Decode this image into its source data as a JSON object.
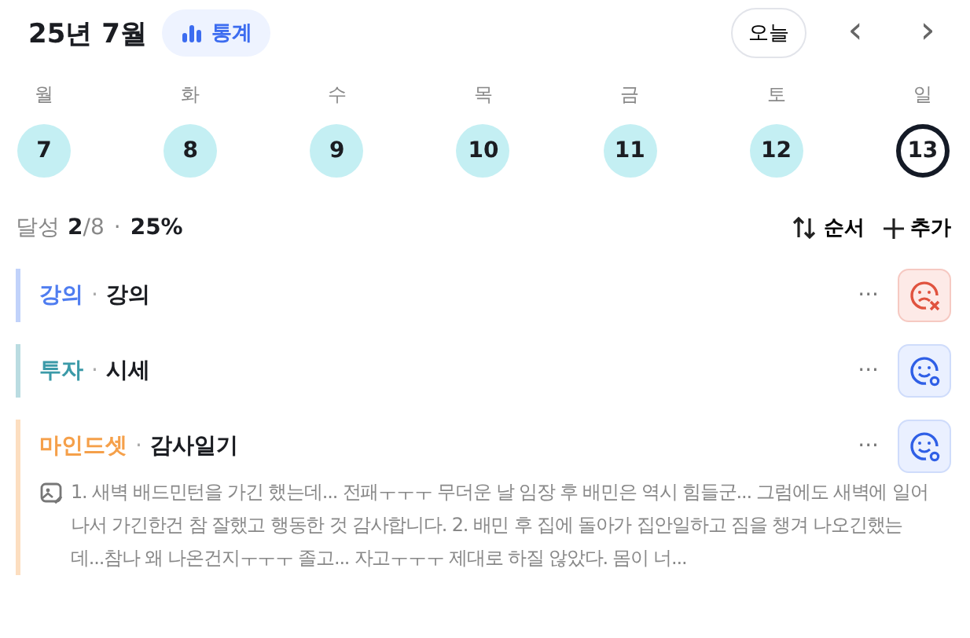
{
  "header": {
    "title": "25년 7월",
    "stats_button": "통계",
    "today_button": "오늘",
    "prev": "‹",
    "next": "›"
  },
  "days": [
    {
      "weekday": "월",
      "date": "7",
      "selected": false
    },
    {
      "weekday": "화",
      "date": "8",
      "selected": false
    },
    {
      "weekday": "수",
      "date": "9",
      "selected": false
    },
    {
      "weekday": "목",
      "date": "10",
      "selected": false
    },
    {
      "weekday": "금",
      "date": "11",
      "selected": false
    },
    {
      "weekday": "토",
      "date": "12",
      "selected": false
    },
    {
      "weekday": "일",
      "date": "13",
      "selected": true
    }
  ],
  "summary": {
    "label": "달성",
    "done": "2",
    "total": "/8",
    "separator": "·",
    "percent": "25%"
  },
  "actions": [
    {
      "kind": "sort",
      "label": "순서"
    },
    {
      "kind": "add",
      "label": "추가"
    }
  ],
  "items": [
    {
      "category": "강의",
      "color": "#4f7df0",
      "separator": "·",
      "title": "강의",
      "kind": "fail",
      "more": "···"
    },
    {
      "category": "투자",
      "color": "#3b9aa8",
      "separator": "·",
      "title": "시세",
      "kind": "done",
      "more": "···"
    },
    {
      "category": "마인드셋",
      "color": "#f5a04a",
      "separator": "·",
      "title": "감사일기",
      "kind": "done",
      "more": "···",
      "note": "1. 새벽 배드민턴을 가긴 했는데... 전패ㅜㅜㅜ 무더운 날 임장 후 배민은 역시 힘들군... 그럼에도 새벽에 일어나서 가긴한건 참 잘했고 행동한 것 감사합니다. 2. 배민 후 집에 돌아가 집안일하고 짐을 챙겨 나오긴했는데...참나 왜 나온건지ㅜㅜㅜ 졸고... 자고ㅜㅜㅜ 제대로 하질 않았다. 몸이 너..."
    }
  ]
}
